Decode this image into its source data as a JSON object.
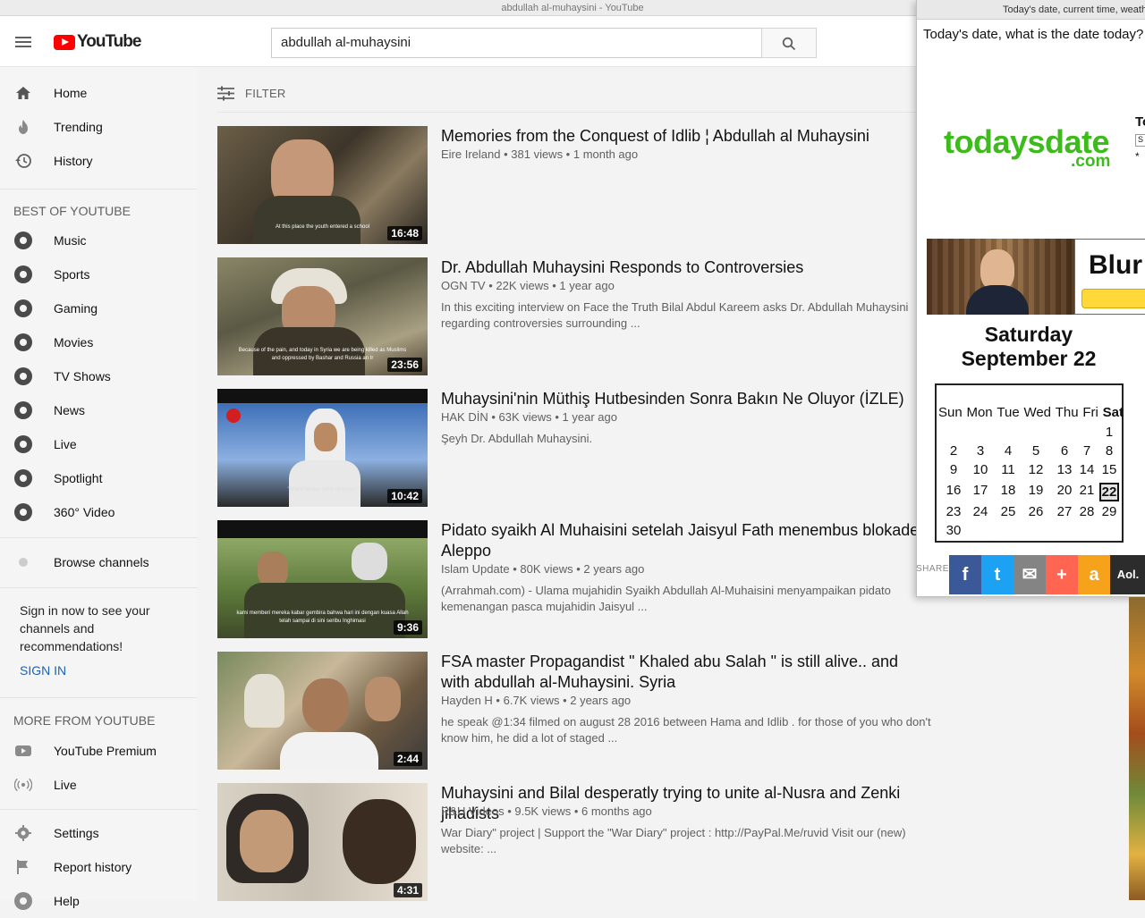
{
  "window": {
    "title": "abdullah al-muhaysini - YouTube"
  },
  "header": {
    "logo_text": "YouTube",
    "search_value": "abdullah al-muhaysini"
  },
  "sidebar": {
    "main": [
      {
        "label": "Home",
        "icon": "home-icon"
      },
      {
        "label": "Trending",
        "icon": "flame-icon"
      },
      {
        "label": "History",
        "icon": "history-icon"
      }
    ],
    "best_title": "BEST OF YOUTUBE",
    "best": [
      {
        "label": "Music",
        "icon": "music-icon"
      },
      {
        "label": "Sports",
        "icon": "sports-icon"
      },
      {
        "label": "Gaming",
        "icon": "gaming-icon"
      },
      {
        "label": "Movies",
        "icon": "movies-icon"
      },
      {
        "label": "TV Shows",
        "icon": "tv-icon"
      },
      {
        "label": "News",
        "icon": "news-icon"
      },
      {
        "label": "Live",
        "icon": "live-icon"
      },
      {
        "label": "Spotlight",
        "icon": "spotlight-icon"
      },
      {
        "label": "360° Video",
        "icon": "360-icon"
      }
    ],
    "browse": "Browse channels",
    "signin_text": "Sign in now to see your channels and recommendations!",
    "signin_link": "SIGN IN",
    "more_title": "MORE FROM YOUTUBE",
    "more": [
      {
        "label": "YouTube Premium",
        "icon": "youtube-premium-icon"
      },
      {
        "label": "Live",
        "icon": "live-broadcast-icon"
      }
    ],
    "settings": [
      {
        "label": "Settings",
        "icon": "gear-icon"
      },
      {
        "label": "Report history",
        "icon": "flag-icon"
      },
      {
        "label": "Help",
        "icon": "help-icon"
      }
    ]
  },
  "filter": {
    "label": "FILTER"
  },
  "results": [
    {
      "title": "Memories from the Conquest of Idlib ¦ Abdullah al Muhaysini",
      "channel": "Eire Ireland",
      "meta": "381 views • 1 month ago",
      "description": "",
      "duration": "16:48",
      "caption": "At this place the youth entered a school",
      "colors": [
        "#4a4436",
        "#2a2620",
        "#8a7a60"
      ]
    },
    {
      "title": "Dr. Abdullah Muhaysini Responds to Controversies",
      "channel": "OGN TV",
      "meta": "22K views • 1 year ago",
      "description": "In this exciting interview on Face the Truth Bilal Abdul Kareem asks Dr. Abdullah Muhaysini regarding controversies surrounding ...",
      "duration": "23:56",
      "caption": "Because of the pain, and today in Syria we are being killed as Muslims and oppressed by Bashar and Russia an Ir",
      "colors": [
        "#6e6a52",
        "#5a4a36",
        "#a9a083"
      ]
    },
    {
      "title": "Muhaysini'nin Müthiş Hutbesinden Sonra Bakın Ne Oluyor (İZLE)",
      "channel": "HAK DİN",
      "meta": "63K views • 1 year ago",
      "description": "Şeyh Dr. Abdullah Muhaysini.",
      "duration": "10:42",
      "caption": "\"Müminlerden şehit olmuştur\"",
      "colors": [
        "#3d6fb8",
        "#8cb0e0",
        "#2a2a2a"
      ]
    },
    {
      "title": "Pidato syaikh Al Muhaisini setelah Jaisyul Fath menembus blokade Aleppo",
      "channel": "Islam Update",
      "meta": "80K views • 2 years ago",
      "description": "(Arrahmah.com) - Ulama mujahidin Syaikh Abdullah Al-Muhaisini menyampaikan pidato kemenangan pasca mujahidin Jaisyul ...",
      "duration": "9:36",
      "caption": "kami memberi mereka kabar gembira bahwa hari ini dengan kuasa Allah telah sampai di sini seribu Inghimasi",
      "colors": [
        "#5d7a3a",
        "#8fa868",
        "#3f4a2a"
      ]
    },
    {
      "title": "FSA master Propagandist \" Khaled abu Salah \" is still alive.. and with abdullah al-Muhaysini. Syria",
      "channel": "Hayden H",
      "meta": "6.7K views • 2 years ago",
      "description": "he speak @1:34 filmed on august 28 2016 between Hama and Idlib . for those of you who don't know him, he did a lot of staged ...",
      "duration": "2:44",
      "caption": "",
      "colors": [
        "#7a8a5e",
        "#c8b89a",
        "#3a3a3a"
      ]
    },
    {
      "title": "Muhaysini and Bilal desperatly trying to unite al-Nusra and Zenki jihadists",
      "channel": "R&U Videos",
      "meta": "9.5K views • 6 months ago",
      "description": "War Diary\" project | Support the \"War Diary\" project : http://PayPal.Me/ruvid Visit our (new) website: ...",
      "duration": "4:31",
      "caption": "",
      "colors": [
        "#c9c2b4",
        "#3b2c22",
        "#e8e0d2"
      ]
    }
  ],
  "popup": {
    "title_bar": "Today's date, current time, weather",
    "question": "Today's date, what is the date today?",
    "logo_main": "todaysdate",
    "logo_com": ".com",
    "side_letter": "To",
    "side_box": "S",
    "side_star": "*",
    "ad_text": "Blur",
    "day": "Saturday",
    "date": "September 22",
    "weekdays": [
      "Sun",
      "Mon",
      "Tue",
      "Wed",
      "Thu",
      "Fri",
      "Sat"
    ],
    "weeks": [
      [
        "",
        "",
        "",
        "",
        "",
        "",
        "1"
      ],
      [
        "2",
        "3",
        "4",
        "5",
        "6",
        "7",
        "8"
      ],
      [
        "9",
        "10",
        "11",
        "12",
        "13",
        "14",
        "15"
      ],
      [
        "16",
        "17",
        "18",
        "19",
        "20",
        "21",
        "22"
      ],
      [
        "23",
        "24",
        "25",
        "26",
        "27",
        "28",
        "29"
      ],
      [
        "30",
        "",
        "",
        "",
        "",
        "",
        ""
      ]
    ],
    "today": "22",
    "share_label": "SHARE",
    "share_buttons": [
      {
        "label": "f",
        "icon": "facebook-icon",
        "color": "#3b5998"
      },
      {
        "label": "t",
        "icon": "twitter-icon",
        "color": "#1da1f2"
      },
      {
        "label": "✉",
        "icon": "email-icon",
        "color": "#848484"
      },
      {
        "label": "+",
        "icon": "more-share-icon",
        "color": "#ff6550"
      },
      {
        "label": "a",
        "icon": "amazon-icon",
        "color": "#f7a21b"
      },
      {
        "label": "Aol.",
        "icon": "aol-icon",
        "color": "#2c2c2c"
      }
    ]
  },
  "colors": {
    "youtube_red": "#ff0000",
    "link_blue": "#1c62b9",
    "todaysdate_green": "#3dbb1c"
  }
}
